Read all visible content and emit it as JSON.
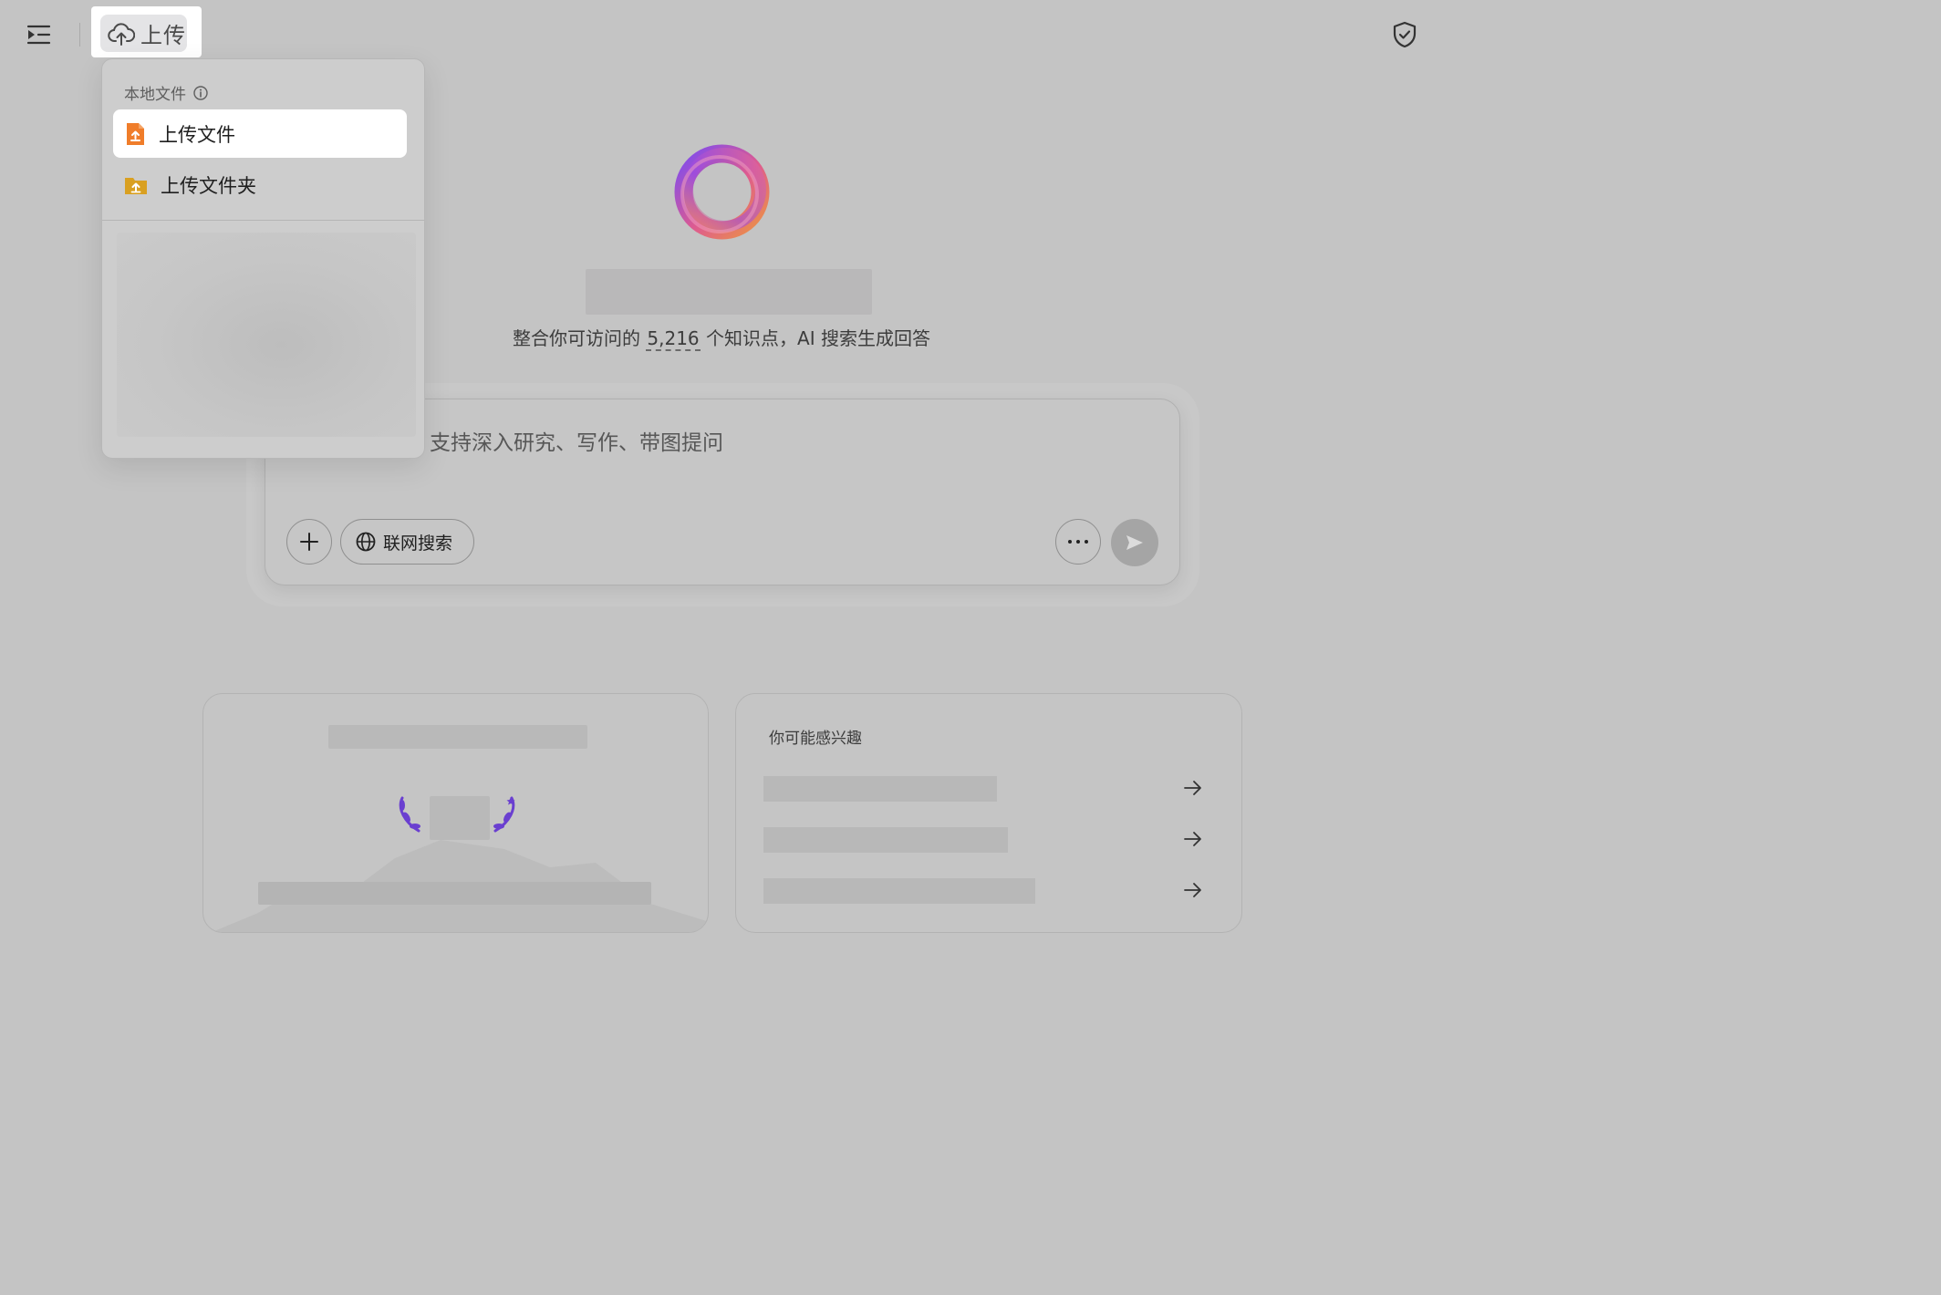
{
  "topbar": {
    "upload_label": "上传",
    "sidebar_toggle_icon": "sidebar-expand-icon",
    "upload_icon": "cloud-upload-icon",
    "shield_icon": "shield-check-icon"
  },
  "upload_menu": {
    "section_title": "本地文件",
    "info_icon": "info-icon",
    "items": [
      {
        "label": "上传文件",
        "icon": "file-upload-icon",
        "color": "#f07d2a",
        "active": true
      },
      {
        "label": "上传文件夹",
        "icon": "folder-upload-icon",
        "color": "#d9a021",
        "active": false
      }
    ]
  },
  "hero": {
    "subtitle_prefix": "整合你可访问的",
    "knowledge_count": "5,216",
    "subtitle_suffix": "个知识点，AI 搜索生成回答"
  },
  "composer": {
    "placeholder": "支持深入研究、写作、带图提问",
    "add_icon": "plus-icon",
    "web_search_label": "联网搜索",
    "web_search_icon": "globe-icon",
    "more_icon": "more-horizontal-icon",
    "send_icon": "send-icon"
  },
  "suggestions": {
    "heading": "你可能感兴趣",
    "arrow_icon": "arrow-right-icon"
  },
  "colors": {
    "overlay_background": "#c4c4c4",
    "brand_gradient": [
      "#7a3ff0",
      "#e04f8a",
      "#f08a3a"
    ]
  }
}
